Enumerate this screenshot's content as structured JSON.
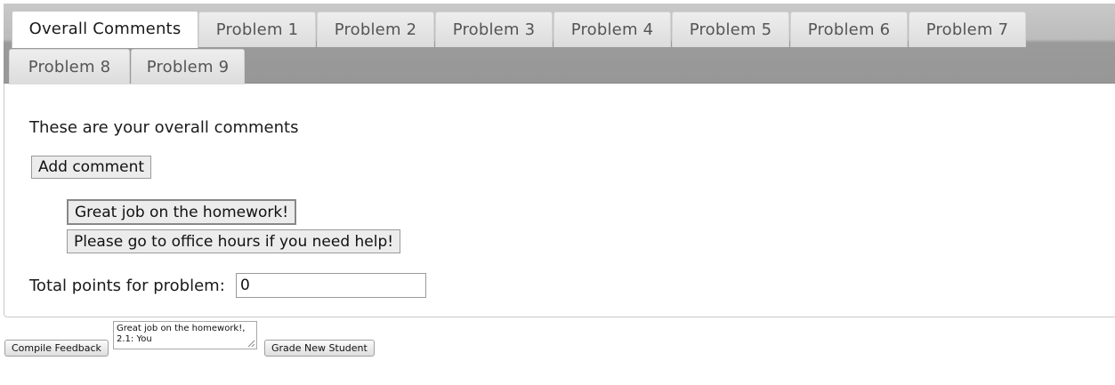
{
  "tabs": [
    {
      "label": "Overall Comments",
      "active": true
    },
    {
      "label": "Problem 1",
      "active": false
    },
    {
      "label": "Problem 2",
      "active": false
    },
    {
      "label": "Problem 3",
      "active": false
    },
    {
      "label": "Problem 4",
      "active": false
    },
    {
      "label": "Problem 5",
      "active": false
    },
    {
      "label": "Problem 6",
      "active": false
    },
    {
      "label": "Problem 7",
      "active": false
    },
    {
      "label": "Problem 8",
      "active": false
    },
    {
      "label": "Problem 9",
      "active": false
    }
  ],
  "content": {
    "intro": "These are your overall comments",
    "add_comment_label": "Add comment",
    "comments": [
      "Great job on the homework!",
      "Please go to office hours if you need help!"
    ],
    "points_label": "Total points for problem:",
    "points_value": "0"
  },
  "footer": {
    "compile_label": "Compile Feedback",
    "feedback_text": "Great job on the homework!, 2.1: You",
    "grade_label": "Grade New Student"
  }
}
